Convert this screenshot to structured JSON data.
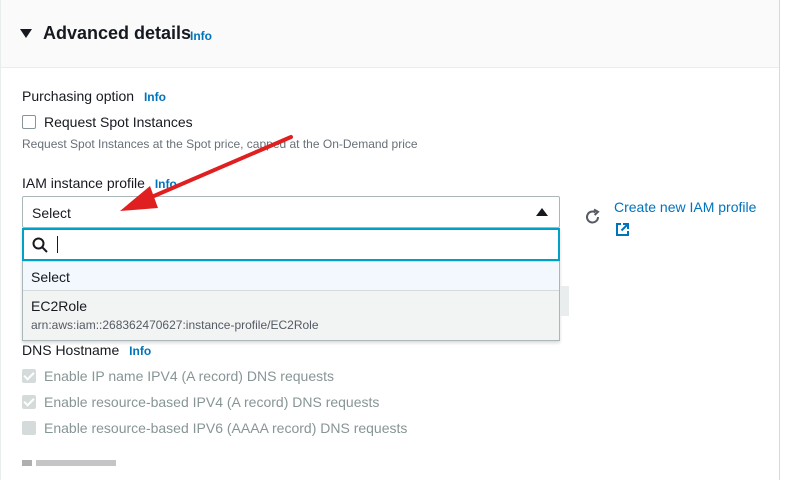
{
  "section": {
    "title": "Advanced details",
    "info": "Info"
  },
  "purchasing": {
    "label": "Purchasing option",
    "info": "Info",
    "checkbox_label": "Request Spot Instances",
    "hint": "Request Spot Instances at the Spot price, capped at the On-Demand price"
  },
  "iam": {
    "label": "IAM instance profile",
    "info": "Info",
    "select_value": "Select",
    "filter_value": "",
    "options": [
      {
        "name": "Select"
      },
      {
        "name": "EC2Role",
        "arn": "arn:aws:iam::268362470627:instance-profile/EC2Role"
      }
    ],
    "create_link": "Create new IAM profile"
  },
  "dns": {
    "label": "DNS Hostname",
    "info": "Info",
    "checkboxes": [
      {
        "label": "Enable IP name IPV4 (A record) DNS requests",
        "checked": true
      },
      {
        "label": "Enable resource-based IPV4 (A record) DNS requests",
        "checked": true
      },
      {
        "label": "Enable resource-based IPV6 (AAAA record) DNS requests",
        "checked": false
      }
    ]
  },
  "colors": {
    "link": "#0073bb",
    "focus": "#00a1c9",
    "annotation_arrow": "#e02020"
  },
  "icons": [
    "caret-down-icon",
    "search-icon",
    "refresh-icon",
    "external-link-icon",
    "annotation-arrow"
  ]
}
